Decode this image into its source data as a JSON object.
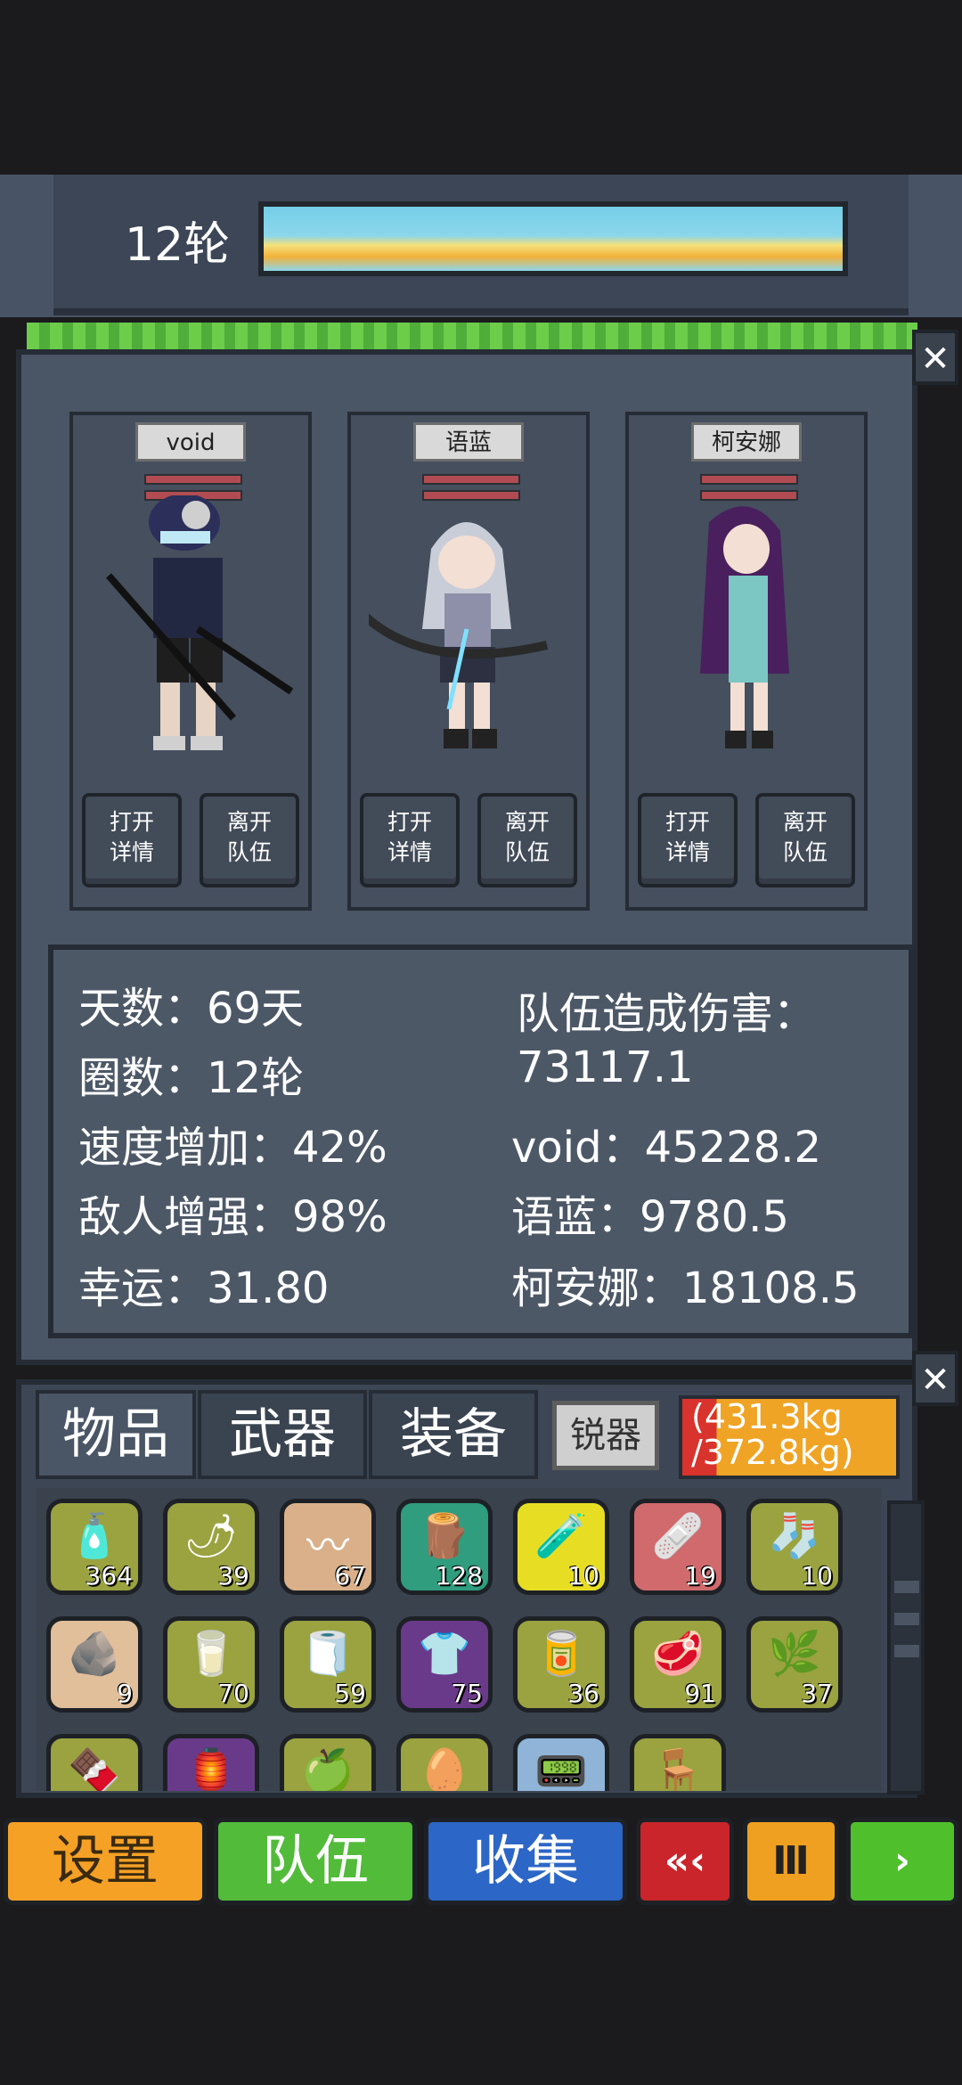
{
  "header": {
    "round_label": "12轮"
  },
  "team": {
    "members": [
      {
        "name": "void",
        "open_label_1": "打开",
        "open_label_2": "详情",
        "leave_label_1": "离开",
        "leave_label_2": "队伍"
      },
      {
        "name": "语蓝",
        "open_label_1": "打开",
        "open_label_2": "详情",
        "leave_label_1": "离开",
        "leave_label_2": "队伍"
      },
      {
        "name": "柯安娜",
        "open_label_1": "打开",
        "open_label_2": "详情",
        "leave_label_1": "离开",
        "leave_label_2": "队伍"
      }
    ],
    "close_label": "✕"
  },
  "stats": {
    "days": "天数：69天",
    "laps": "圈数：12轮",
    "speed": "速度增加：42%",
    "enemy": "敌人增强：98%",
    "luck": "幸运：31.80",
    "damage_title": "队伍造成伤害：",
    "damage_total": "73117.1",
    "damage_void": "void：45228.2",
    "damage_yulan": "语蓝：9780.5",
    "damage_keanna": "柯安娜：18108.5"
  },
  "inventory": {
    "close_label": "✕",
    "tabs": [
      "物品",
      "武器",
      "装备"
    ],
    "sharp_label": "锐器",
    "weight_current": "(431.3kg",
    "weight_max": "/372.8kg)",
    "slots": [
      {
        "icon": "supplies-icon",
        "glyph": "🧴",
        "count": "364",
        "color": "#9aa33f"
      },
      {
        "icon": "chili-icon",
        "glyph": "🌶",
        "count": "39",
        "color": "#9aa33f"
      },
      {
        "icon": "rope-icon",
        "glyph": "〰",
        "count": "67",
        "color": "#d9b08a"
      },
      {
        "icon": "wood-log-icon",
        "glyph": "🪵",
        "count": "128",
        "color": "#2f9d7e"
      },
      {
        "icon": "potion-icon",
        "glyph": "🧪",
        "count": "10",
        "color": "#e7de24"
      },
      {
        "icon": "medkit-icon",
        "glyph": "🩹",
        "count": "19",
        "color": "#d06a6d"
      },
      {
        "icon": "boots-icon",
        "glyph": "🧦",
        "count": "10",
        "color": "#9aa33f"
      },
      {
        "icon": "stone-icon",
        "glyph": "🪨",
        "count": "9",
        "color": "#e1bf9b"
      },
      {
        "icon": "bottle-icon",
        "glyph": "🥛",
        "count": "70",
        "color": "#9aa33f"
      },
      {
        "icon": "cloth-icon",
        "glyph": "🧻",
        "count": "59",
        "color": "#9aa33f"
      },
      {
        "icon": "shirt-icon",
        "glyph": "👕",
        "count": "75",
        "color": "#6a3a8a"
      },
      {
        "icon": "meat-can-icon",
        "glyph": "🥫",
        "count": "36",
        "color": "#9aa33f"
      },
      {
        "icon": "steak-icon",
        "glyph": "🥩",
        "count": "91",
        "color": "#9aa33f"
      },
      {
        "icon": "herb-icon",
        "glyph": "🌿",
        "count": "37",
        "color": "#9aa33f"
      },
      {
        "icon": "chocolate-icon",
        "glyph": "🍫",
        "count": "",
        "color": "#9aa33f"
      },
      {
        "icon": "lantern-icon",
        "glyph": "🏮",
        "count": "",
        "color": "#6a3a8a"
      },
      {
        "icon": "apple-icon",
        "glyph": "🍏",
        "count": "",
        "color": "#9aa33f"
      },
      {
        "icon": "egg-icon",
        "glyph": "🥚",
        "count": "",
        "color": "#9aa33f"
      },
      {
        "icon": "circuit-icon",
        "glyph": "📟",
        "count": "",
        "color": "#8fb4d8"
      },
      {
        "icon": "chair-icon",
        "glyph": "🪑",
        "count": "",
        "color": "#9aa33f"
      }
    ]
  },
  "nav": {
    "settings": "设置",
    "team": "队伍",
    "collect": "收集",
    "rewind": "«‹",
    "pause": "Ⅲ",
    "play": "›"
  }
}
